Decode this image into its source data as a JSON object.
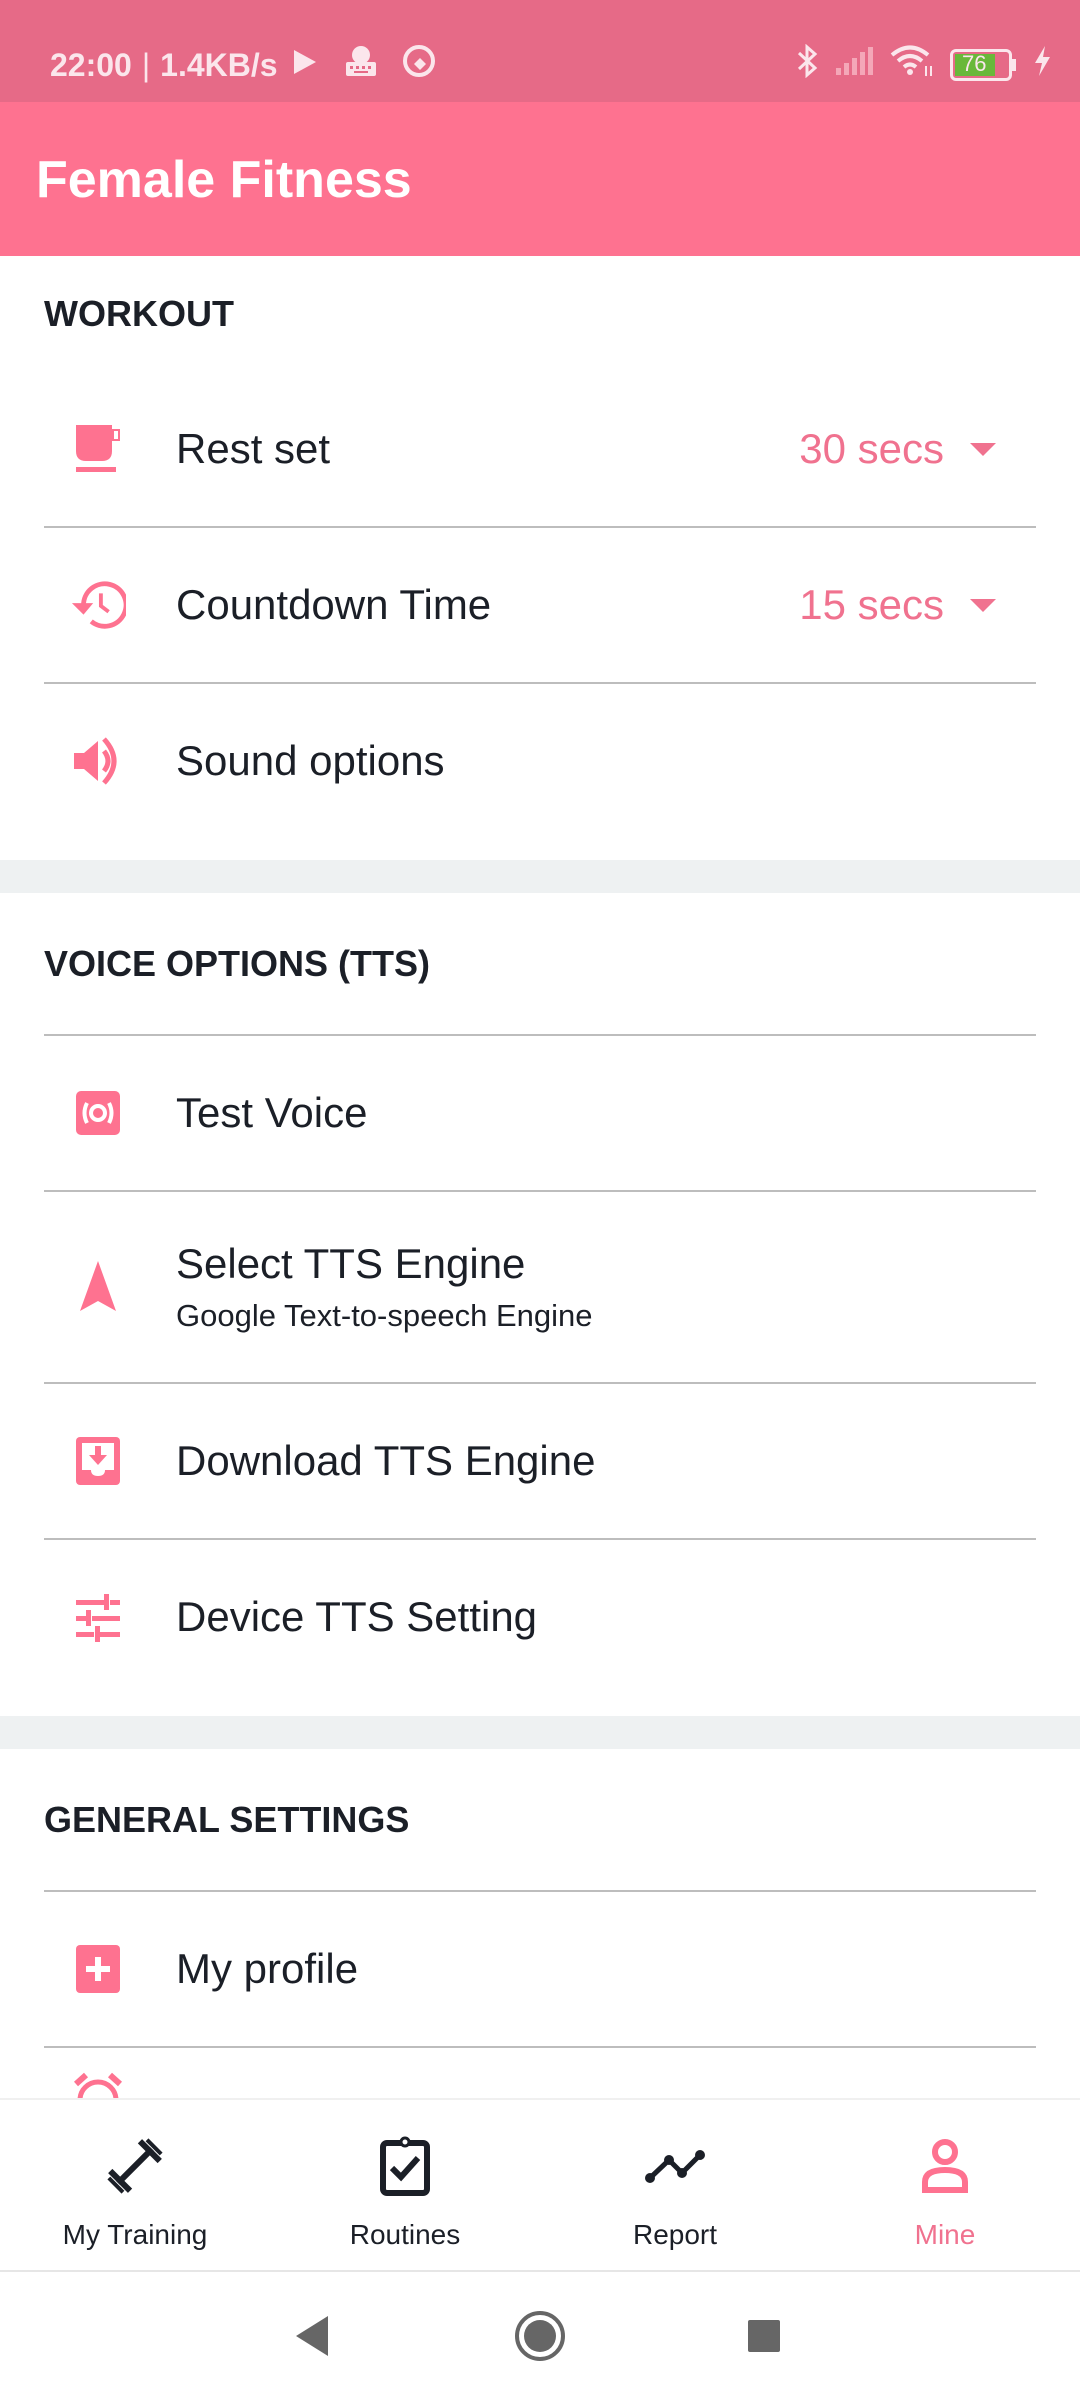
{
  "status_bar": {
    "time": "22:00",
    "net_speed": "1.4KB/s",
    "battery": "76",
    "icons": [
      "play-icon",
      "keyboard-app-icon",
      "q-app-icon",
      "bluetooth-icon",
      "signal-icon",
      "wifi-icon",
      "battery-icon",
      "charging-icon"
    ]
  },
  "app": {
    "title": "Female Fitness",
    "accent": "#fe7290"
  },
  "sections": {
    "workout": {
      "title": "WORKOUT",
      "items": [
        {
          "label": "Rest set",
          "value": "30 secs",
          "icon": "coffee-cup-icon"
        },
        {
          "label": "Countdown Time",
          "value": "15 secs",
          "icon": "history-clock-icon"
        },
        {
          "label": "Sound options",
          "icon": "volume-icon"
        }
      ]
    },
    "voice": {
      "title": "VOICE OPTIONS (TTS)",
      "items": [
        {
          "label": "Test Voice",
          "icon": "speaker-test-icon"
        },
        {
          "label": "Select TTS Engine",
          "sub": "Google Text-to-speech Engine",
          "icon": "navigation-arrow-icon"
        },
        {
          "label": "Download TTS Engine",
          "icon": "download-box-icon"
        },
        {
          "label": "Device TTS Setting",
          "icon": "sliders-icon"
        }
      ]
    },
    "general": {
      "title": "GENERAL SETTINGS",
      "items": [
        {
          "label": "My profile",
          "icon": "plus-box-icon"
        }
      ]
    }
  },
  "bottom_nav": {
    "items": [
      {
        "label": "My Training",
        "icon": "dumbbell-icon",
        "active": false
      },
      {
        "label": "Routines",
        "icon": "clipboard-check-icon",
        "active": false
      },
      {
        "label": "Report",
        "icon": "line-chart-icon",
        "active": false
      },
      {
        "label": "Mine",
        "icon": "person-icon",
        "active": true
      }
    ]
  }
}
